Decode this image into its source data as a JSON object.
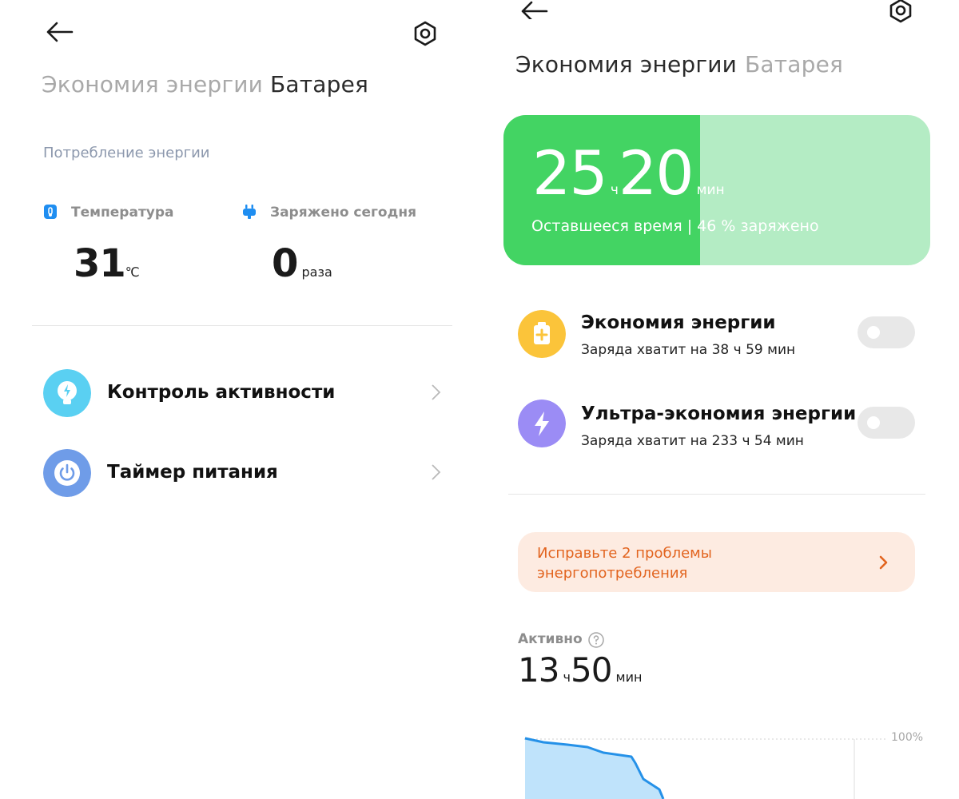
{
  "left": {
    "tabs": [
      {
        "label": "Экономия энергии",
        "active": false
      },
      {
        "label": "Батарея",
        "active": true
      }
    ],
    "section_label": "Потребление энергии",
    "stats": {
      "temperature": {
        "label": "Температура",
        "value": "31",
        "unit": "℃",
        "icon": "thermometer-icon"
      },
      "charged_today": {
        "label": "Заряжено сегодня",
        "value": "0",
        "unit": "раза",
        "icon": "plug-icon"
      }
    },
    "rows": [
      {
        "title": "Контроль активности",
        "icon": "lightbulb-icon",
        "color": "#5ad0f2"
      },
      {
        "title": "Таймер питания",
        "icon": "power-icon",
        "color": "#6f9ce8"
      }
    ]
  },
  "right": {
    "tabs": [
      {
        "label": "Экономия энергии",
        "active": true
      },
      {
        "label": "Батарея",
        "active": false
      }
    ],
    "battery": {
      "hours": "25",
      "hours_unit": "ч",
      "minutes": "20",
      "minutes_unit": "мин",
      "remaining_label": "Оставшееся время | 46 % заряжено",
      "charge_fraction": 0.46,
      "fill_color": "#43d463",
      "track_color": "#b4ecc4"
    },
    "modes": [
      {
        "title": "Экономия энергии",
        "subtitle": "Заряда хватит на 38 ч 59 мин",
        "icon": "battery-plus-icon",
        "color": "#fbc43a",
        "enabled": false
      },
      {
        "title": "Ультра-экономия энергии",
        "subtitle": "Заряда хватит на 233 ч 54 мин",
        "icon": "lightning-icon",
        "color": "#9b8cf5",
        "enabled": false
      }
    ],
    "issue_banner": {
      "text": "Исправьте 2 проблемы энергопотребления",
      "color": "#e2641f",
      "background": "#fdebe1"
    },
    "active": {
      "label": "Активно",
      "hours": "13",
      "hours_unit": "ч",
      "minutes": "50",
      "minutes_unit": "мин"
    },
    "chart": {
      "axis_top_label": "100%"
    }
  }
}
